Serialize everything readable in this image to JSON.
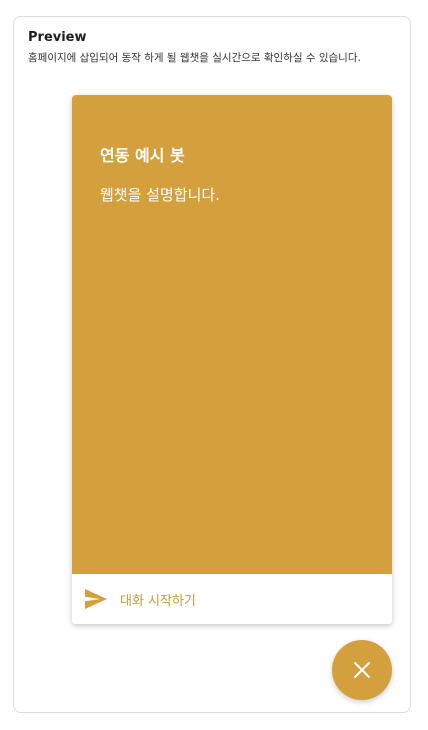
{
  "preview": {
    "title": "Preview",
    "description": "홈페이지에 삽입되어 동작 하게 될 웹챗을 실시간으로 확인하실 수 있습니다."
  },
  "widget": {
    "bot_name": "연동 예시 봇",
    "bot_description": "웹챗을 설명합니다.",
    "start_label": "대화 시작하기",
    "start_icon": "send-icon"
  },
  "fab": {
    "icon": "close-icon"
  },
  "colors": {
    "accent": "#d4a03d",
    "start_text": "#c99a40"
  }
}
